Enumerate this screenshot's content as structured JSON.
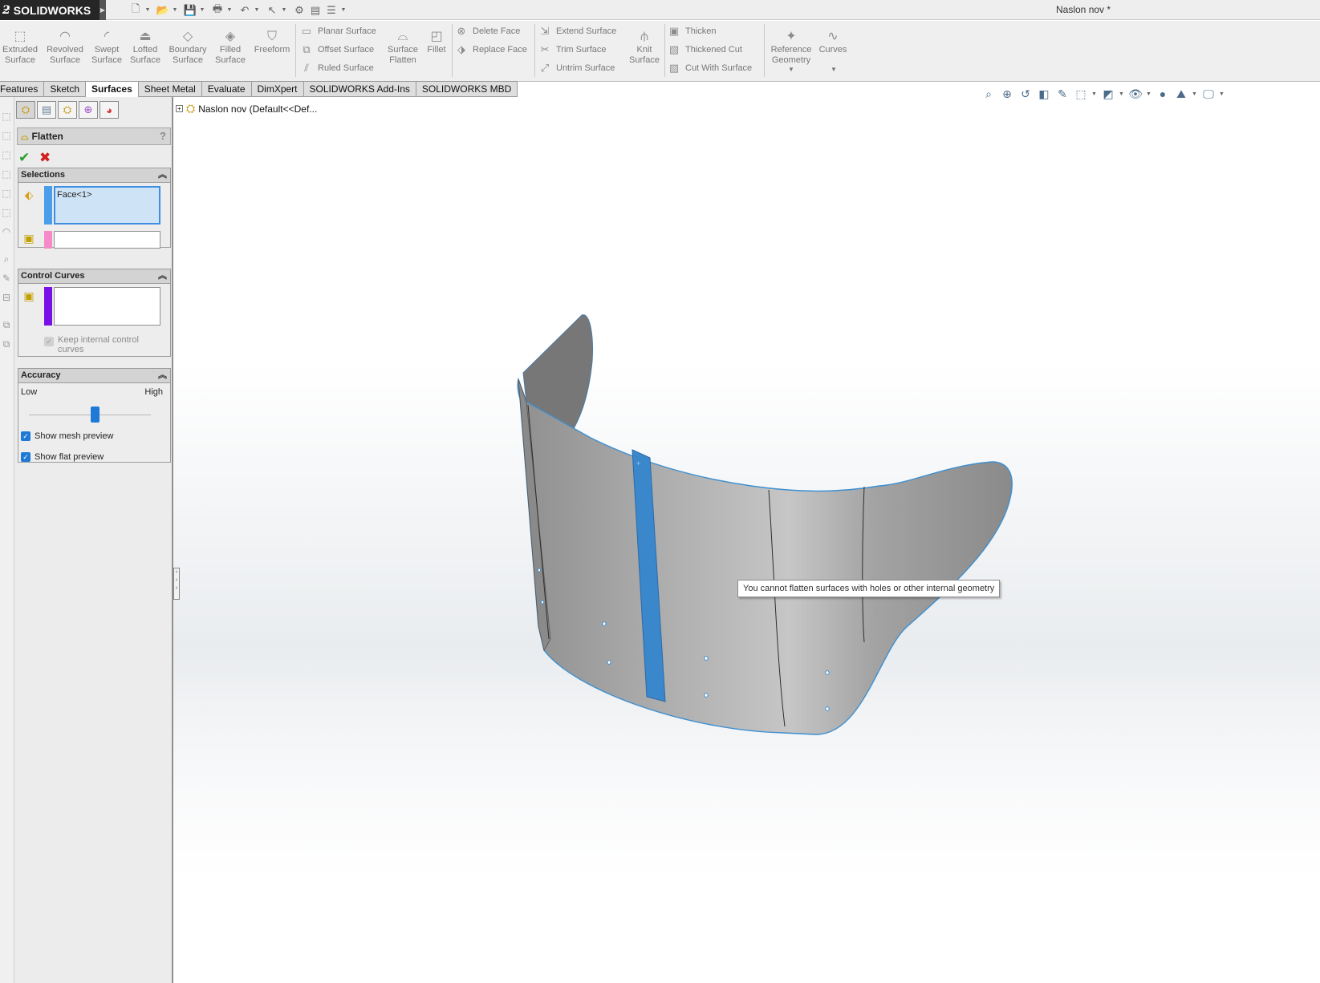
{
  "app": {
    "name": "SOLIDWORKS",
    "document_title": "Naslon nov *"
  },
  "ribbon": {
    "big_buttons": [
      {
        "label": "Extruded Surface",
        "line1": "Extruded",
        "line2": "Surface",
        "icon": "extruded-surface-icon"
      },
      {
        "label": "Revolved Surface",
        "line1": "Revolved",
        "line2": "Surface",
        "icon": "revolved-surface-icon"
      },
      {
        "label": "Swept Surface",
        "line1": "Swept",
        "line2": "Surface",
        "icon": "swept-surface-icon"
      },
      {
        "label": "Lofted Surface",
        "line1": "Lofted",
        "line2": "Surface",
        "icon": "lofted-surface-icon"
      },
      {
        "label": "Boundary Surface",
        "line1": "Boundary",
        "line2": "Surface",
        "icon": "boundary-surface-icon"
      },
      {
        "label": "Filled Surface",
        "line1": "Filled",
        "line2": "Surface",
        "icon": "filled-surface-icon"
      },
      {
        "label": "Freeform",
        "line1": "Freeform",
        "line2": "",
        "icon": "freeform-icon"
      },
      {
        "label": "Surface Flatten",
        "line1": "Surface",
        "line2": "Flatten",
        "icon": "surface-flatten-icon"
      },
      {
        "label": "Fillet",
        "line1": "Fillet",
        "line2": "",
        "icon": "fillet-icon"
      },
      {
        "label": "Knit Surface",
        "line1": "Knit",
        "line2": "Surface",
        "icon": "knit-surface-icon"
      },
      {
        "label": "Reference Geometry",
        "line1": "Reference",
        "line2": "Geometry",
        "icon": "reference-geometry-icon"
      },
      {
        "label": "Curves",
        "line1": "Curves",
        "line2": "",
        "icon": "curves-icon"
      }
    ],
    "small_buttons": {
      "planar_surface": "Planar Surface",
      "offset_surface": "Offset Surface",
      "ruled_surface": "Ruled Surface",
      "delete_face": "Delete Face",
      "replace_face": "Replace Face",
      "extend_surface": "Extend Surface",
      "trim_surface": "Trim Surface",
      "untrim_surface": "Untrim Surface",
      "thicken": "Thicken",
      "thickened_cut": "Thickened Cut",
      "cut_with_surface": "Cut With Surface"
    }
  },
  "tabs": [
    {
      "label": "Features",
      "active": false
    },
    {
      "label": "Sketch",
      "active": false
    },
    {
      "label": "Surfaces",
      "active": true
    },
    {
      "label": "Sheet Metal",
      "active": false
    },
    {
      "label": "Evaluate",
      "active": false
    },
    {
      "label": "DimXpert",
      "active": false
    },
    {
      "label": "SOLIDWORKS Add-Ins",
      "active": false
    },
    {
      "label": "SOLIDWORKS MBD",
      "active": false
    }
  ],
  "feature_tree": {
    "root_label": "Naslon nov  (Default<<Def..."
  },
  "property_manager": {
    "title": "Flatten",
    "help": "?",
    "selections": {
      "header": "Selections",
      "face_value": "Face<1>",
      "vertex_value": "",
      "face_color": "#4a9de8",
      "vertex_color": "#f58ac8"
    },
    "control_curves": {
      "header": "Control Curves",
      "value": "",
      "color": "#7a10e8",
      "keep_internal_label": "Keep internal control curves",
      "keep_internal_line1": "Keep internal control",
      "keep_internal_line2": "curves",
      "keep_internal_checked": true,
      "keep_internal_enabled": false
    },
    "accuracy": {
      "header": "Accuracy",
      "low_label": "Low",
      "high_label": "High",
      "slider_level": 0.54,
      "show_mesh_preview_label": "Show mesh preview",
      "show_mesh_preview_checked": true,
      "show_flat_preview_label": "Show flat preview",
      "show_flat_preview_checked": true
    }
  },
  "graphics": {
    "tooltip": "You cannot flatten surfaces with holes or other internal geometry",
    "highlight_color": "#3a87cc",
    "surface_color": "#a8a8a8"
  }
}
